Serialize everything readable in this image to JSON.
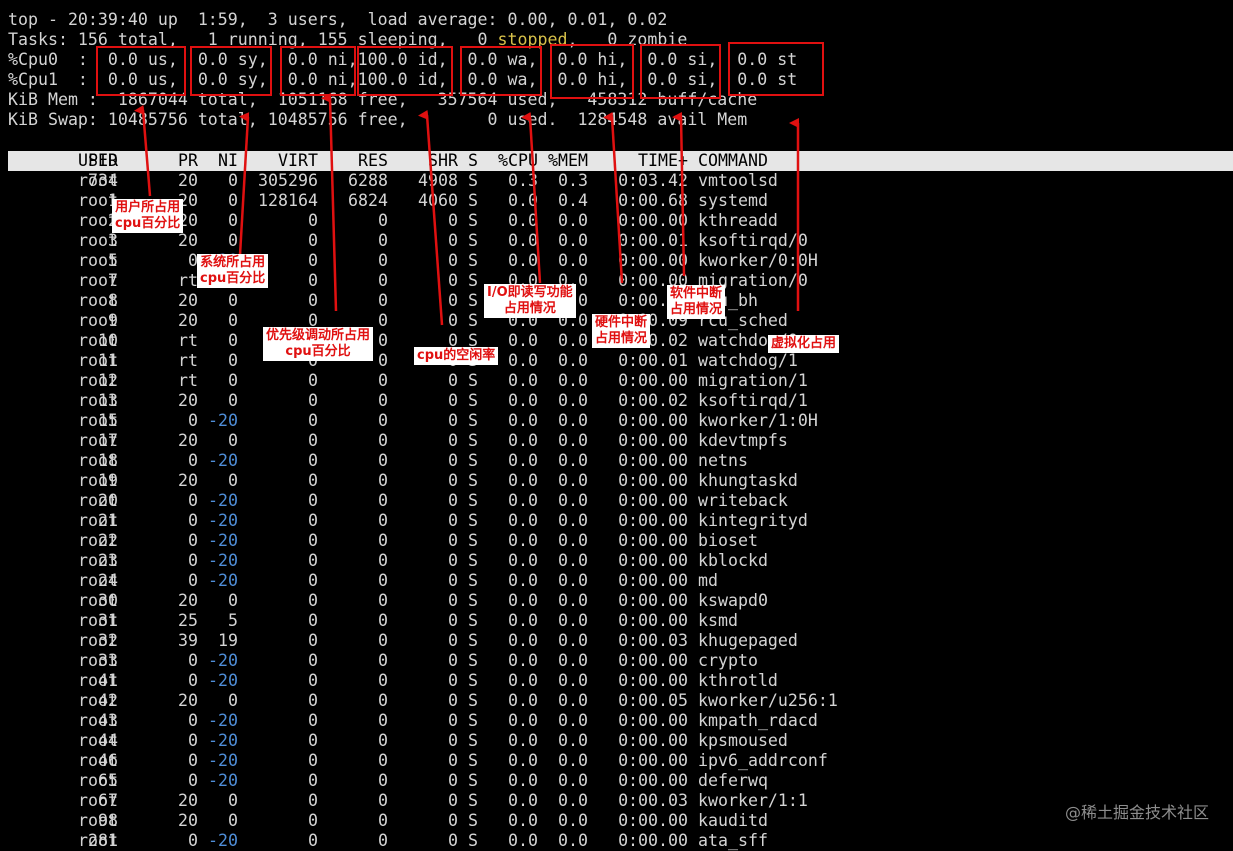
{
  "summary": {
    "line1": "top - 20:39:40 up  1:59,  3 users,  load average: 0.00, 0.01, 0.02",
    "tasks_pre": "Tasks: 156 total,   1 running, 155 sleeping,   0 ",
    "tasks_stopped": "stopped",
    "tasks_post": ",   0 zombie",
    "cpu0": "%Cpu0  :  0.0 us,  0.0 sy,  0.0 ni,100.0 id,  0.0 wa,  0.0 hi,  0.0 si,  0.0 st",
    "cpu1": "%Cpu1  :  0.0 us,  0.0 sy,  0.0 ni,100.0 id,  0.0 wa,  0.0 hi,  0.0 si,  0.0 st",
    "mem": "KiB Mem :  1867044 total,  1051168 free,   357564 used,   458312 buff/cache",
    "swap": "KiB Swap: 10485756 total, 10485756 free,        0 used.  1284548 avail Mem"
  },
  "table": {
    "headers": {
      "pid": "PID",
      "user": "USER",
      "pr": "PR",
      "ni": "NI",
      "virt": "VIRT",
      "res": "RES",
      "shr": "SHR",
      "s": "S",
      "cpu": "%CPU",
      "mem": "%MEM",
      "time": "TIME+",
      "command": "COMMAND"
    },
    "rows": [
      [
        "734",
        "root",
        "20",
        "0",
        "305296",
        "6288",
        "4908",
        "S",
        "0.3",
        "0.3",
        "0:03.42",
        "vmtoolsd"
      ],
      [
        "1",
        "root",
        "20",
        "0",
        "128164",
        "6824",
        "4060",
        "S",
        "0.0",
        "0.4",
        "0:00.68",
        "systemd"
      ],
      [
        "2",
        "root",
        "20",
        "0",
        "0",
        "0",
        "0",
        "S",
        "0.0",
        "0.0",
        "0:00.00",
        "kthreadd"
      ],
      [
        "3",
        "root",
        "20",
        "0",
        "0",
        "0",
        "0",
        "S",
        "0.0",
        "0.0",
        "0:00.01",
        "ksoftirqd/0"
      ],
      [
        "5",
        "root",
        "0",
        "-20",
        "0",
        "0",
        "0",
        "S",
        "0.0",
        "0.0",
        "0:00.00",
        "kworker/0:0H"
      ],
      [
        "7",
        "root",
        "rt",
        "0",
        "0",
        "0",
        "0",
        "S",
        "0.0",
        "0.0",
        "0:00.00",
        "migration/0"
      ],
      [
        "8",
        "root",
        "20",
        "0",
        "0",
        "0",
        "0",
        "S",
        "0.0",
        "0.0",
        "0:00.00",
        "rcu_bh"
      ],
      [
        "9",
        "root",
        "20",
        "0",
        "0",
        "0",
        "0",
        "S",
        "0.0",
        "0.0",
        "0:00.09",
        "rcu_sched"
      ],
      [
        "10",
        "root",
        "rt",
        "0",
        "0",
        "0",
        "0",
        "S",
        "0.0",
        "0.0",
        "0:00.02",
        "watchdog/0"
      ],
      [
        "11",
        "root",
        "rt",
        "0",
        "0",
        "0",
        "0",
        "S",
        "0.0",
        "0.0",
        "0:00.01",
        "watchdog/1"
      ],
      [
        "12",
        "root",
        "rt",
        "0",
        "0",
        "0",
        "0",
        "S",
        "0.0",
        "0.0",
        "0:00.00",
        "migration/1"
      ],
      [
        "13",
        "root",
        "20",
        "0",
        "0",
        "0",
        "0",
        "S",
        "0.0",
        "0.0",
        "0:00.02",
        "ksoftirqd/1"
      ],
      [
        "15",
        "root",
        "0",
        "-20",
        "0",
        "0",
        "0",
        "S",
        "0.0",
        "0.0",
        "0:00.00",
        "kworker/1:0H"
      ],
      [
        "17",
        "root",
        "20",
        "0",
        "0",
        "0",
        "0",
        "S",
        "0.0",
        "0.0",
        "0:00.00",
        "kdevtmpfs"
      ],
      [
        "18",
        "root",
        "0",
        "-20",
        "0",
        "0",
        "0",
        "S",
        "0.0",
        "0.0",
        "0:00.00",
        "netns"
      ],
      [
        "19",
        "root",
        "20",
        "0",
        "0",
        "0",
        "0",
        "S",
        "0.0",
        "0.0",
        "0:00.00",
        "khungtaskd"
      ],
      [
        "20",
        "root",
        "0",
        "-20",
        "0",
        "0",
        "0",
        "S",
        "0.0",
        "0.0",
        "0:00.00",
        "writeback"
      ],
      [
        "21",
        "root",
        "0",
        "-20",
        "0",
        "0",
        "0",
        "S",
        "0.0",
        "0.0",
        "0:00.00",
        "kintegrityd"
      ],
      [
        "22",
        "root",
        "0",
        "-20",
        "0",
        "0",
        "0",
        "S",
        "0.0",
        "0.0",
        "0:00.00",
        "bioset"
      ],
      [
        "23",
        "root",
        "0",
        "-20",
        "0",
        "0",
        "0",
        "S",
        "0.0",
        "0.0",
        "0:00.00",
        "kblockd"
      ],
      [
        "24",
        "root",
        "0",
        "-20",
        "0",
        "0",
        "0",
        "S",
        "0.0",
        "0.0",
        "0:00.00",
        "md"
      ],
      [
        "30",
        "root",
        "20",
        "0",
        "0",
        "0",
        "0",
        "S",
        "0.0",
        "0.0",
        "0:00.00",
        "kswapd0"
      ],
      [
        "31",
        "root",
        "25",
        "5",
        "0",
        "0",
        "0",
        "S",
        "0.0",
        "0.0",
        "0:00.00",
        "ksmd"
      ],
      [
        "32",
        "root",
        "39",
        "19",
        "0",
        "0",
        "0",
        "S",
        "0.0",
        "0.0",
        "0:00.03",
        "khugepaged"
      ],
      [
        "33",
        "root",
        "0",
        "-20",
        "0",
        "0",
        "0",
        "S",
        "0.0",
        "0.0",
        "0:00.00",
        "crypto"
      ],
      [
        "41",
        "root",
        "0",
        "-20",
        "0",
        "0",
        "0",
        "S",
        "0.0",
        "0.0",
        "0:00.00",
        "kthrotld"
      ],
      [
        "42",
        "root",
        "20",
        "0",
        "0",
        "0",
        "0",
        "S",
        "0.0",
        "0.0",
        "0:00.05",
        "kworker/u256:1"
      ],
      [
        "43",
        "root",
        "0",
        "-20",
        "0",
        "0",
        "0",
        "S",
        "0.0",
        "0.0",
        "0:00.00",
        "kmpath_rdacd"
      ],
      [
        "44",
        "root",
        "0",
        "-20",
        "0",
        "0",
        "0",
        "S",
        "0.0",
        "0.0",
        "0:00.00",
        "kpsmoused"
      ],
      [
        "46",
        "root",
        "0",
        "-20",
        "0",
        "0",
        "0",
        "S",
        "0.0",
        "0.0",
        "0:00.00",
        "ipv6_addrconf"
      ],
      [
        "65",
        "root",
        "0",
        "-20",
        "0",
        "0",
        "0",
        "S",
        "0.0",
        "0.0",
        "0:00.00",
        "deferwq"
      ],
      [
        "67",
        "root",
        "20",
        "0",
        "0",
        "0",
        "0",
        "S",
        "0.0",
        "0.0",
        "0:00.03",
        "kworker/1:1"
      ],
      [
        "98",
        "root",
        "20",
        "0",
        "0",
        "0",
        "0",
        "S",
        "0.0",
        "0.0",
        "0:00.00",
        "kauditd"
      ],
      [
        "281",
        "root",
        "0",
        "-20",
        "0",
        "0",
        "0",
        "S",
        "0.0",
        "0.0",
        "0:00.00",
        "ata_sff"
      ]
    ]
  },
  "annotations": {
    "us": "用户所占用\ncpu百分比",
    "sy": "系统所占用\ncpu百分比",
    "ni": "优先级调动所占用\ncpu百分比",
    "id": "cpu的空闲率",
    "wa": "I/O即读写功能\n占用情况",
    "hi": "硬件中断\n占用情况",
    "si": "软件中断\n占用情况",
    "st": "虚拟化占用"
  },
  "watermark": "@稀土掘金技术社区",
  "colors": {
    "background": "#000000",
    "text": "#d4d4d4",
    "header_bar": "#e6e6e6",
    "negative_nice": "#4f8ed8",
    "stopped": "#d7c14a",
    "annotation": "#e01010"
  }
}
